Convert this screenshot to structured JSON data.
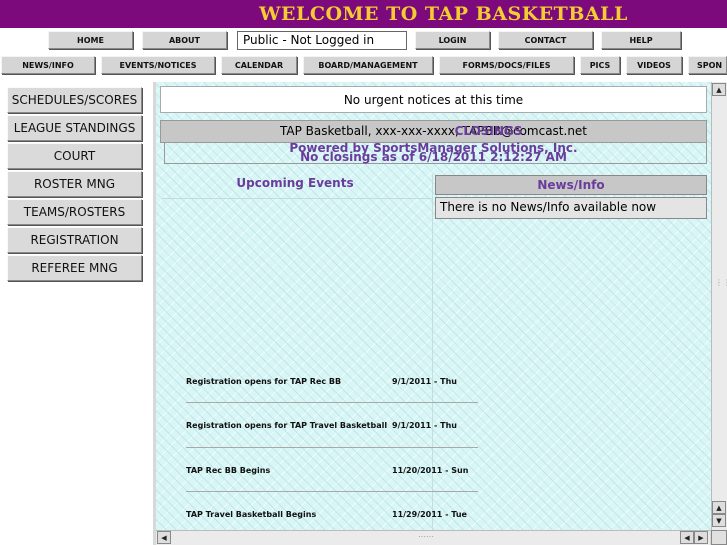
{
  "banner": {
    "title": "WELCOME TO TAP BASKETBALL"
  },
  "topnav": {
    "home": "HOME",
    "about": "ABOUT",
    "status": "Public - Not Logged in",
    "login": "LOGIN",
    "contact": "CONTACT",
    "help": "HELP"
  },
  "secnav": [
    "NEWS/INFO",
    "EVENTS/NOTICES",
    "CALENDAR",
    "BOARD/MANAGEMENT",
    "FORMS/DOCS/FILES",
    "PICS",
    "VIDEOS",
    "SPON"
  ],
  "sidebar": [
    "SCHEDULES/SCORES",
    "LEAGUE STANDINGS",
    "COURT",
    "ROSTER MNG",
    "TEAMS/ROSTERS",
    "REGISTRATION",
    "REFEREE MNG"
  ],
  "notices": {
    "urgent": "No urgent notices at this time",
    "contact_line": "TAP Basketball, xxx-xxx-xxxx, TAPBB@comcast.net",
    "closings": "CLOSINGS",
    "powered_by": "Powered by SportsManager Solutions, Inc.",
    "no_closings": "No closings as of 6/18/2011 2:12:27 AM"
  },
  "events": {
    "header": "Upcoming Events",
    "items": [
      {
        "title": "Registration opens for TAP Rec BB",
        "date": "9/1/2011 - Thu"
      },
      {
        "title": "Registration opens for TAP Travel Basketball",
        "date": "9/1/2011 - Thu"
      },
      {
        "title": "TAP Rec BB Begins",
        "date": "11/20/2011 - Sun"
      },
      {
        "title": "TAP Travel Basketball Begins",
        "date": "11/29/2011 - Tue"
      }
    ]
  },
  "news": {
    "header": "News/Info",
    "empty": "There is no News/Info available now"
  },
  "colors": {
    "banner_bg": "#7d0a7d",
    "banner_text": "#f2cc30",
    "accent_purple": "#6a3c9c",
    "content_bg": "#d8f6f6"
  }
}
